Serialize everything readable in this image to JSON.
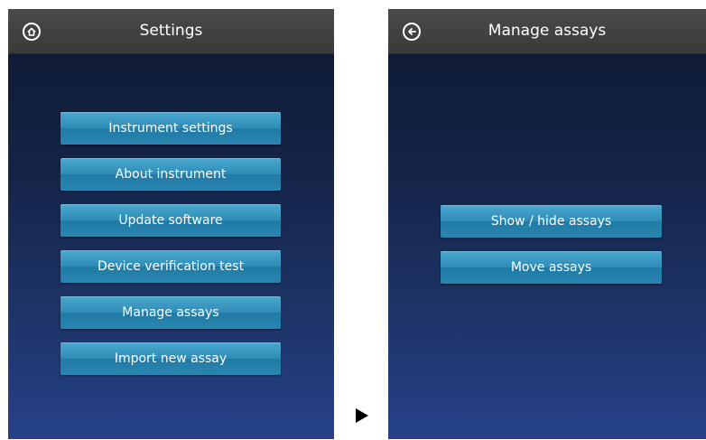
{
  "settings_screen": {
    "title": "Settings",
    "nav_icon": "home-icon",
    "buttons": [
      {
        "label": "Instrument settings"
      },
      {
        "label": "About instrument"
      },
      {
        "label": "Update software"
      },
      {
        "label": "Device verification test"
      },
      {
        "label": "Manage assays"
      },
      {
        "label": "Import new assay"
      }
    ]
  },
  "transition_icon": "right-arrow-icon",
  "manage_screen": {
    "title": "Manage assays",
    "nav_icon": "back-arrow-icon",
    "buttons": [
      {
        "label": "Show / hide assays"
      },
      {
        "label": "Move assays"
      }
    ]
  },
  "colors": {
    "titlebar": "#3f3f3f",
    "background_top": "#0d1830",
    "background_bottom": "#27418a",
    "button": "#2e8bb6"
  }
}
